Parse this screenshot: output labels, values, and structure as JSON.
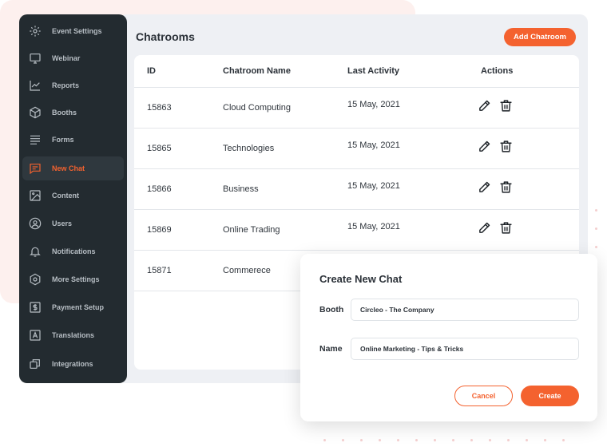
{
  "page": {
    "title": "Chatrooms",
    "add_button": "Add Chatroom"
  },
  "colors": {
    "accent": "#f4622f",
    "sidebar_bg": "#232b30",
    "sidebar_text": "#b7bec4",
    "page_bg": "#eef0f4"
  },
  "sidebar": {
    "items": [
      {
        "label": "Event Settings",
        "icon": "gear-icon"
      },
      {
        "label": "Webinar",
        "icon": "monitor-icon"
      },
      {
        "label": "Reports",
        "icon": "chart-icon"
      },
      {
        "label": "Booths",
        "icon": "box-icon"
      },
      {
        "label": "Forms",
        "icon": "list-icon"
      },
      {
        "label": "New Chat",
        "icon": "chat-icon",
        "active": true
      },
      {
        "label": "Content",
        "icon": "image-icon"
      },
      {
        "label": "Users",
        "icon": "user-icon"
      },
      {
        "label": "Notifications",
        "icon": "bell-icon"
      },
      {
        "label": "More Settings",
        "icon": "settings-hex-icon"
      },
      {
        "label": "Payment Setup",
        "icon": "dollar-icon"
      },
      {
        "label": "Translations",
        "icon": "translate-icon"
      },
      {
        "label": "Integrations",
        "icon": "integrations-icon"
      }
    ]
  },
  "table": {
    "columns": [
      "ID",
      "Chatroom Name",
      "Last Activity",
      "Actions"
    ],
    "rows": [
      {
        "id": "15863",
        "name": "Cloud Computing",
        "last_activity": "15 May, 2021"
      },
      {
        "id": "15865",
        "name": "Technologies",
        "last_activity": "15 May, 2021"
      },
      {
        "id": "15866",
        "name": "Business",
        "last_activity": "15 May, 2021"
      },
      {
        "id": "15869",
        "name": "Online Trading",
        "last_activity": "15 May, 2021"
      },
      {
        "id": "15871",
        "name": "Commerece",
        "last_activity": ""
      }
    ],
    "action_icons": [
      "pencil-icon",
      "trash-icon"
    ]
  },
  "modal": {
    "title": "Create New Chat",
    "booth_label": "Booth",
    "booth_value": "Circleo - The Company",
    "name_label": "Name",
    "name_value": "Online Marketing - Tips & Tricks",
    "cancel_label": "Cancel",
    "create_label": "Create"
  }
}
